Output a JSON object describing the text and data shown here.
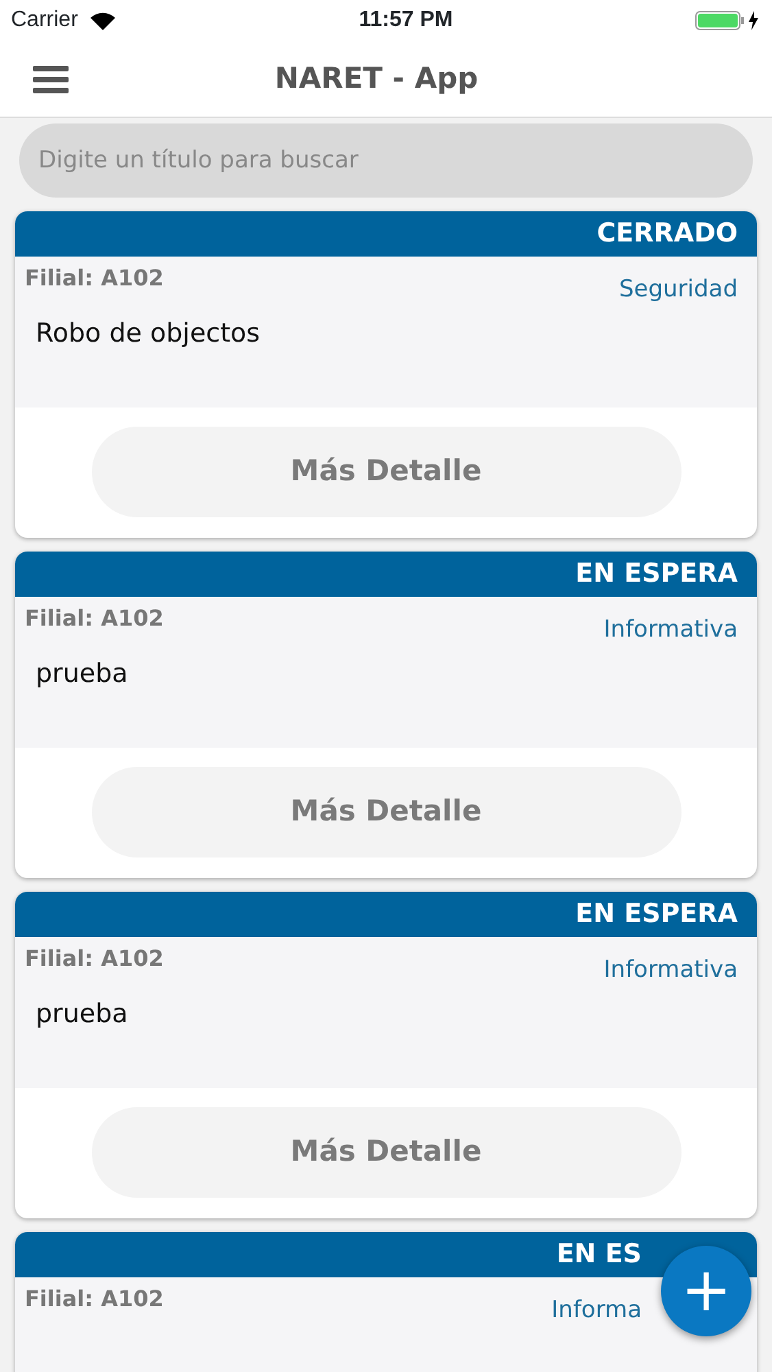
{
  "status_bar": {
    "carrier": "Carrier",
    "time": "11:57 PM"
  },
  "header": {
    "title": "NARET - App"
  },
  "search": {
    "placeholder": "Digite un título para buscar"
  },
  "cards": [
    {
      "status": "CERRADO",
      "branch": "Filial: A102",
      "category": "Seguridad",
      "title": "Robo de objectos",
      "button": "Más Detalle"
    },
    {
      "status": "EN ESPERA",
      "branch": "Filial: A102",
      "category": "Informativa",
      "title": "prueba",
      "button": "Más Detalle"
    },
    {
      "status": "EN ESPERA",
      "branch": "Filial: A102",
      "category": "Informativa",
      "title": "prueba",
      "button": "Más Detalle"
    },
    {
      "status": "EN ES",
      "branch": "Filial: A102",
      "category": "Informa"
    }
  ],
  "fab": {
    "label": "+"
  }
}
